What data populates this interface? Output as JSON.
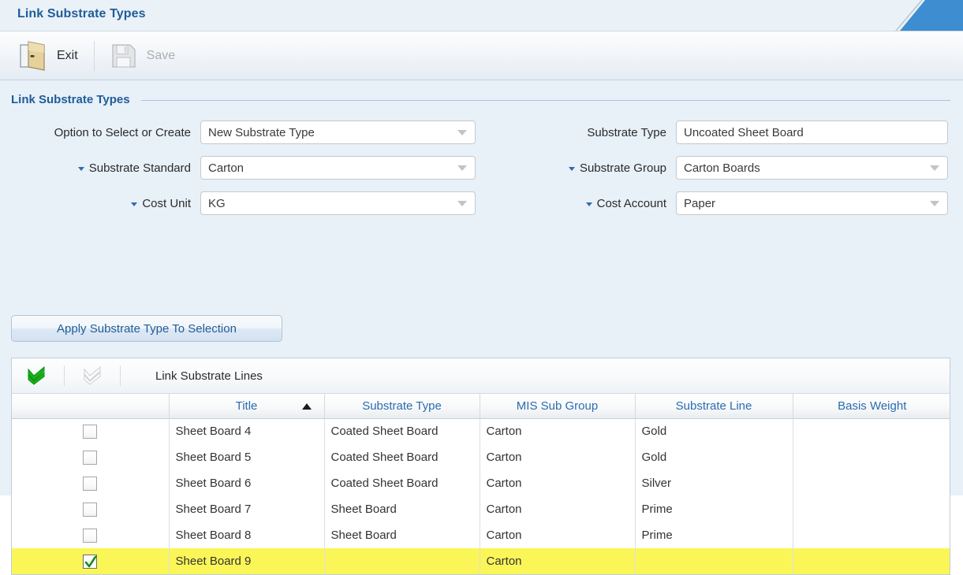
{
  "window": {
    "title": "Link Substrate Types",
    "tab_accent_color": "#3d8dd0"
  },
  "toolbar": {
    "exit_label": "Exit",
    "exit_icon": "door-icon",
    "save_label": "Save",
    "save_icon": "floppy-disk-icon",
    "save_disabled": true
  },
  "section": {
    "title": "Link Substrate Types"
  },
  "form": {
    "left": [
      {
        "label": "Option to Select or Create",
        "value": "New Substrate Type",
        "type": "dropdown",
        "marker": false
      },
      {
        "label": "Substrate Standard",
        "value": "Carton",
        "type": "dropdown",
        "marker": true
      },
      {
        "label": "Cost Unit",
        "value": "KG",
        "type": "dropdown",
        "marker": true
      }
    ],
    "right": [
      {
        "label": "Substrate Type",
        "value": "Uncoated Sheet Board",
        "type": "text",
        "marker": false
      },
      {
        "label": "Substrate Group",
        "value": "Carton Boards",
        "type": "dropdown",
        "marker": true
      },
      {
        "label": "Cost Account",
        "value": "Paper",
        "type": "dropdown",
        "marker": true
      }
    ],
    "apply_button": "Apply Substrate Type To Selection"
  },
  "grid": {
    "toolbar": {
      "select_all_icon": "double-check-green-icon",
      "deselect_all_icon": "double-check-gray-icon",
      "title": "Link Substrate Lines"
    },
    "columns": [
      {
        "label": "",
        "key": "checkbox"
      },
      {
        "label": "Title",
        "key": "title",
        "sort": "asc"
      },
      {
        "label": "Substrate Type",
        "key": "substrate_type"
      },
      {
        "label": "MIS Sub Group",
        "key": "mis_sub_group"
      },
      {
        "label": "Substrate Line",
        "key": "substrate_line"
      },
      {
        "label": "Basis Weight",
        "key": "basis_weight"
      }
    ],
    "rows": [
      {
        "checked": false,
        "selected": false,
        "title": "Sheet Board 4",
        "substrate_type": "Coated Sheet Board",
        "mis_sub_group": "Carton",
        "substrate_line": "Gold",
        "basis_weight": ""
      },
      {
        "checked": false,
        "selected": false,
        "title": "Sheet Board 5",
        "substrate_type": "Coated Sheet Board",
        "mis_sub_group": "Carton",
        "substrate_line": "Gold",
        "basis_weight": ""
      },
      {
        "checked": false,
        "selected": false,
        "title": "Sheet Board 6",
        "substrate_type": "Coated Sheet Board",
        "mis_sub_group": "Carton",
        "substrate_line": "Silver",
        "basis_weight": ""
      },
      {
        "checked": false,
        "selected": false,
        "title": "Sheet Board 7",
        "substrate_type": "Sheet Board",
        "mis_sub_group": "Carton",
        "substrate_line": "Prime",
        "basis_weight": ""
      },
      {
        "checked": false,
        "selected": false,
        "title": "Sheet Board 8",
        "substrate_type": "Sheet Board",
        "mis_sub_group": "Carton",
        "substrate_line": "Prime",
        "basis_weight": ""
      },
      {
        "checked": true,
        "selected": true,
        "title": "Sheet Board 9",
        "substrate_type": "",
        "mis_sub_group": "Carton",
        "substrate_line": "",
        "basis_weight": ""
      }
    ],
    "selected_row_color": "#fbf658"
  }
}
